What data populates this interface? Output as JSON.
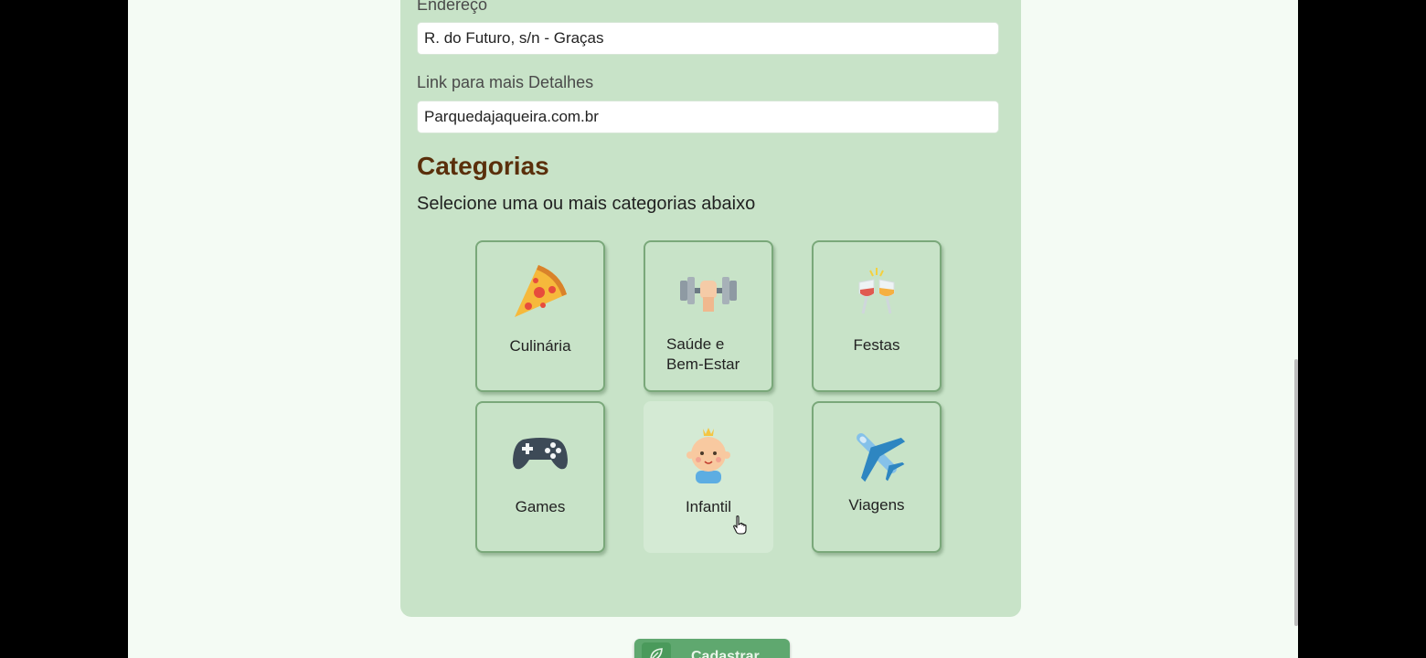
{
  "form": {
    "address": {
      "label": "Endereço",
      "value": "R. do Futuro, s/n - Graças"
    },
    "details_link": {
      "label": "Link para mais Detalhes",
      "value": "Parquedajaqueira.com.br"
    }
  },
  "categories": {
    "title": "Categorias",
    "subtitle": "Selecione uma ou mais categorias abaixo",
    "items": [
      {
        "label": "Culinária",
        "icon": "pizza-icon"
      },
      {
        "label_line1": "Saúde e",
        "label_line2": "Bem-Estar",
        "icon": "dumbbell-icon"
      },
      {
        "label": "Festas",
        "icon": "wine-glasses-icon"
      },
      {
        "label": "Games",
        "icon": "gamepad-icon"
      },
      {
        "label": "Infantil",
        "icon": "baby-icon",
        "state": "hovered"
      },
      {
        "label": "Viagens",
        "icon": "airplane-icon"
      }
    ]
  },
  "submit": {
    "label": "Cadastrar",
    "icon": "leaf-icon"
  },
  "colors": {
    "card_bg": "#c8e3c8",
    "title": "#5a2f0b",
    "button": "#5fa86f"
  }
}
